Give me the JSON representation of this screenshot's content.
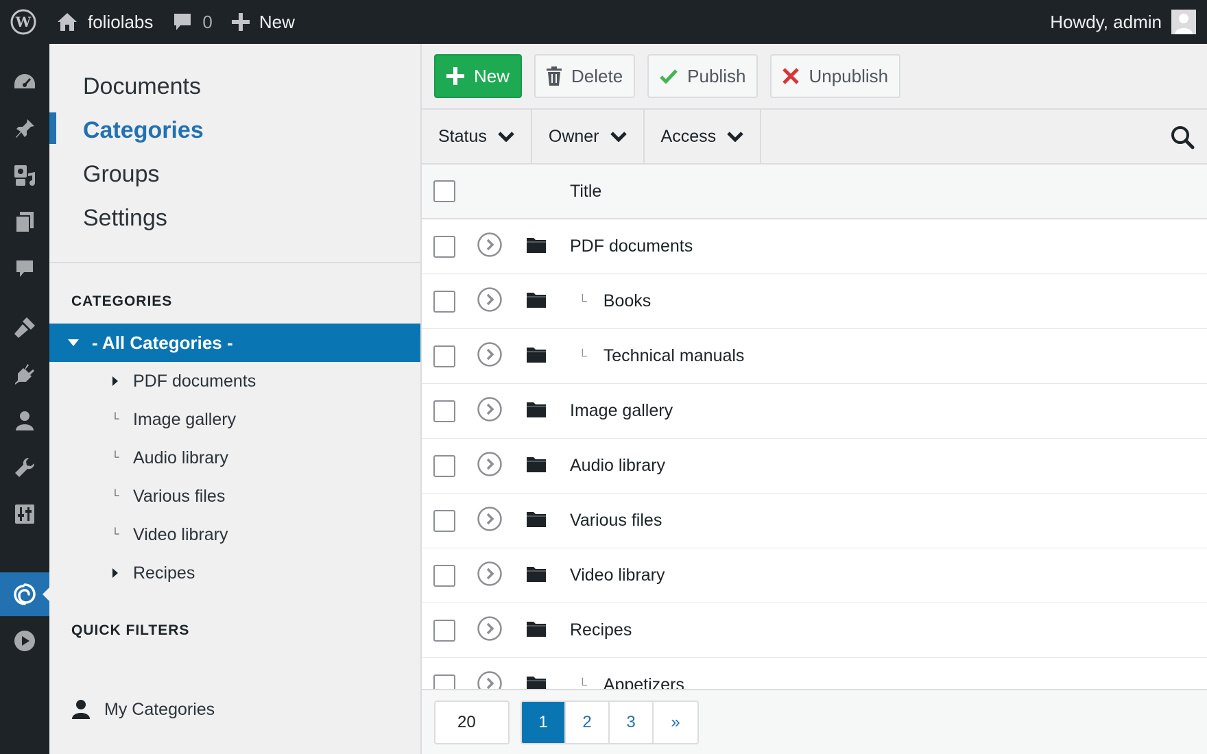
{
  "adminbar": {
    "site_name": "foliolabs",
    "comments_count": "0",
    "new_label": "New",
    "howdy": "Howdy, admin"
  },
  "sidebar": {
    "nav": [
      {
        "label": "Documents",
        "current": false
      },
      {
        "label": "Categories",
        "current": true
      },
      {
        "label": "Groups",
        "current": false
      },
      {
        "label": "Settings",
        "current": false
      }
    ],
    "categories_heading": "CATEGORIES",
    "all_categories": "- All Categories -",
    "tree": [
      {
        "label": "PDF documents",
        "type": "expandable"
      },
      {
        "label": "Image gallery",
        "type": "leaf"
      },
      {
        "label": "Audio library",
        "type": "leaf"
      },
      {
        "label": "Various files",
        "type": "leaf"
      },
      {
        "label": "Video library",
        "type": "leaf"
      },
      {
        "label": "Recipes",
        "type": "expandable"
      }
    ],
    "quick_filters_heading": "QUICK FILTERS",
    "my_categories": "My Categories"
  },
  "toolbar": {
    "new_label": "New",
    "delete_label": "Delete",
    "publish_label": "Publish",
    "unpublish_label": "Unpublish"
  },
  "filters": {
    "status": "Status",
    "owner": "Owner",
    "access": "Access"
  },
  "table": {
    "title_header": "Title",
    "rows": [
      {
        "title": "PDF documents",
        "level": 0
      },
      {
        "title": "Books",
        "level": 1
      },
      {
        "title": "Technical manuals",
        "level": 1
      },
      {
        "title": "Image gallery",
        "level": 0
      },
      {
        "title": "Audio library",
        "level": 0
      },
      {
        "title": "Various files",
        "level": 0
      },
      {
        "title": "Video library",
        "level": 0
      },
      {
        "title": "Recipes",
        "level": 0
      },
      {
        "title": "Appetizers",
        "level": 1
      }
    ]
  },
  "pager": {
    "limit": "20",
    "pages": [
      "1",
      "2",
      "3",
      "»"
    ],
    "current": "1"
  },
  "colors": {
    "admin_dark": "#1d2327",
    "accent_blue": "#0a75b3",
    "primary_green": "#1eaa53",
    "delete_red": "#d63638",
    "publish_green": "#46b450"
  }
}
